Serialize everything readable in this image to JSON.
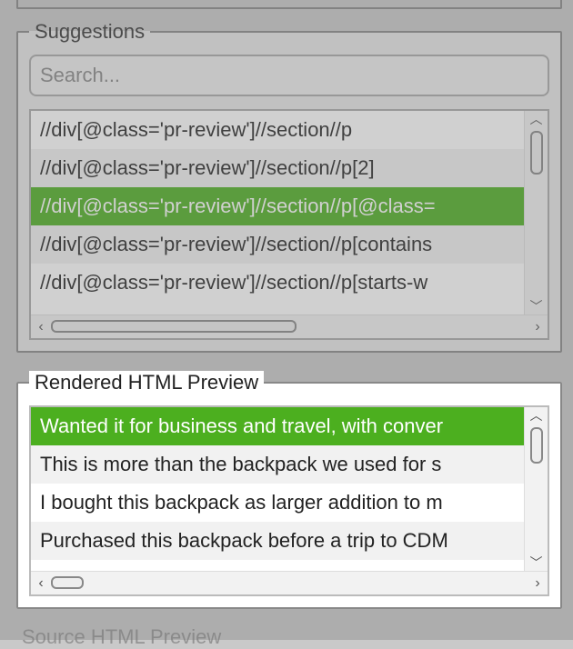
{
  "panels": {
    "suggestions": {
      "legend": "Suggestions",
      "search_placeholder": "Search...",
      "items": [
        "//div[@class='pr-review']//section//p",
        "//div[@class='pr-review']//section//p[2]",
        "//div[@class='pr-review']//section//p[@class=",
        "//div[@class='pr-review']//section//p[contains",
        "//div[@class='pr-review']//section//p[starts-w"
      ],
      "selected_index": 2
    },
    "rendered_preview": {
      "legend": "Rendered HTML Preview",
      "items": [
        "Wanted it for business and travel, with conver",
        "This is more than the backpack we used for s",
        "I bought this backpack as larger addition to m",
        "Purchased this backpack before a trip to CDM"
      ],
      "selected_index": 0
    },
    "source_preview": {
      "legend_partial": "Source HTML Preview"
    }
  }
}
